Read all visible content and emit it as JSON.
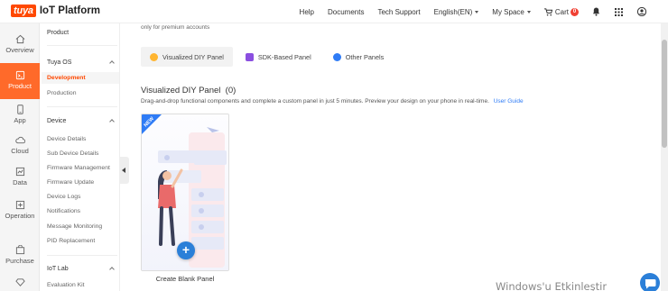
{
  "header": {
    "logo_badge": "tuya",
    "logo_text": "IoT Platform",
    "nav": {
      "help": "Help",
      "documents": "Documents",
      "tech_support": "Tech Support",
      "language": "English(EN)",
      "my_space": "My Space",
      "cart": "Cart",
      "cart_count": "0"
    }
  },
  "rail": {
    "items": [
      {
        "label": "Overview",
        "icon": "home-icon"
      },
      {
        "label": "Product",
        "icon": "product-icon"
      },
      {
        "label": "App",
        "icon": "app-icon"
      },
      {
        "label": "Cloud",
        "icon": "cloud-icon"
      },
      {
        "label": "Data",
        "icon": "data-icon"
      },
      {
        "label": "Operation",
        "icon": "operation-icon"
      },
      {
        "label": "Purchase",
        "icon": "purchase-icon"
      }
    ],
    "active": "Product"
  },
  "sidebar": {
    "top_item": "Product",
    "tuya_os": {
      "label": "Tuya OS",
      "items": [
        "Development",
        "Production"
      ]
    },
    "device": {
      "label": "Device",
      "items": [
        "Device Details",
        "Sub Device Details",
        "Firmware Management",
        "Firmware Update",
        "Device Logs",
        "Notifications",
        "Message Monitoring",
        "PID Replacement"
      ]
    },
    "iot_lab": {
      "label": "IoT Lab",
      "items": [
        "Evaluation Kit"
      ]
    }
  },
  "main": {
    "premium_note": "only for premium accounts",
    "tabs": [
      "Visualized DIY Panel",
      "SDK-Based Panel",
      "Other Panels"
    ],
    "section_title": "Visualized DIY Panel",
    "section_count": "(0)",
    "section_desc": "Drag-and-drop functional components and complete a custom panel in just 5 minutes. Preview your design on your phone in real-time.",
    "user_guide": "User Guide",
    "card_badge": "NEW",
    "card_label": "Create Blank Panel",
    "card_button": "+"
  },
  "watermark": "Windows'u Etkinleştir",
  "colors": {
    "brand": "#ff4800",
    "active_rail": "#ff6a2a",
    "link": "#2f7cf6",
    "card_plus": "#2b7fd8"
  }
}
